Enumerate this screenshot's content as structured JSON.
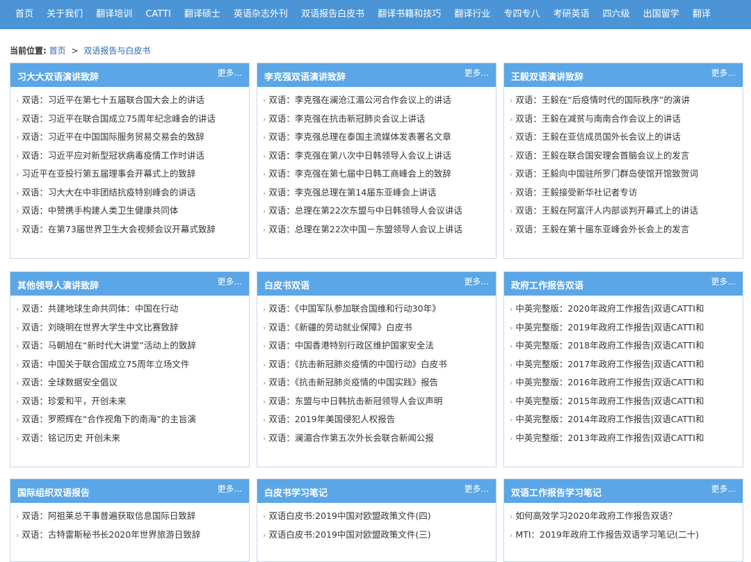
{
  "nav": [
    "首页",
    "关于我们",
    "翻译培训",
    "CATTI",
    "翻译硕士",
    "英语杂志外刊",
    "双语报告白皮书",
    "翻译书籍和技巧",
    "翻译行业",
    "专四专八",
    "考研英语",
    "四六级",
    "出国留学",
    "翻译"
  ],
  "breadcrumb": {
    "prefix": "当前位置:",
    "home": "首页",
    "sep": ">",
    "current": "双语报告与白皮书"
  },
  "more_label": "更多...",
  "panels": [
    {
      "title": "习大大双语演讲致辞",
      "items": [
        "双语：习近平在第七十五届联合国大会上的讲话",
        "双语：习近平在联合国成立75周年纪念峰会的讲话",
        "双语：习近平在中国国际服务贸易交易会的致辞",
        "双语：习近平应对新型冠状病毒疫情工作时讲话",
        "习近平在亚投行第五届理事会开幕式上的致辞",
        "双语：习大大在中非团结抗疫特别峰会的讲话",
        "双语：中赞携手构建人类卫生健康共同体",
        "双语：在第73届世界卫生大会视频会议开幕式致辞"
      ]
    },
    {
      "title": "李克强双语演讲致辞",
      "items": [
        "双语：李克强在澜沧江湄公河合作会议上的讲话",
        "双语：李克强在抗击新冠肺炎会议上讲话",
        "双语：李克强总理在泰国主流媒体发表署名文章",
        "双语：李克强在第八次中日韩领导人会议上讲话",
        "双语：李克强在第七届中日韩工商峰会上的致辞",
        "双语：李克强总理在第14届东亚峰会上讲话",
        "双语：总理在第22次东盟与中日韩领导人会议讲话",
        "双语：总理在第22次中国－东盟领导人会议上讲话"
      ]
    },
    {
      "title": "王毅双语演讲致辞",
      "items": [
        "双语：王毅在“后疫情时代的国际秩序”的演讲",
        "双语：王毅在减贫与南南合作会议上的讲话",
        "双语：王毅在亚信成员国外长会议上的讲话",
        "双语：王毅在联合国安理会首脑会议上的发言",
        "双语：王毅向中国驻所罗门群岛使馆开馆致贺词",
        "双语：王毅接受新华社记者专访",
        "双语：王毅在阿富汗人内部谈判开幕式上的讲话",
        "双语：王毅在第十届东亚峰会外长会上的发言"
      ]
    },
    {
      "title": "其他领导人演讲致辞",
      "items": [
        "双语：共建地球生命共同体：中国在行动",
        "双语：刘晓明在世界大学生中文比赛致辞",
        "双语：马朝旭在“新时代大讲堂”活动上的致辞",
        "双语：中国关于联合国成立75周年立场文件",
        "双语：全球数据安全倡议",
        "双语：珍爱和平，开创未来",
        "双语：罗照辉在“合作视角下的南海”的主旨演",
        "双语：铭记历史 开创未来"
      ]
    },
    {
      "title": "白皮书双语",
      "items": [
        "双语：《中国军队参加联合国维和行动30年》",
        "双语：《新疆的劳动就业保障》白皮书",
        "双语：中国香港特别行政区维护国家安全法",
        "双语：《抗击新冠肺炎疫情的中国行动》白皮书",
        "双语：《抗击新冠肺炎疫情的中国实践》报告",
        "双语：东盟与中日韩抗击新冠领导人会议声明",
        "双语：2019年美国侵犯人权报告",
        "双语：澜湄合作第五次外长会联合新闻公报"
      ]
    },
    {
      "title": "政府工作报告双语",
      "items": [
        "中英完整版：2020年政府工作报告|双语CATTI和",
        "中英完整版：2019年政府工作报告|双语CATTI和",
        "中英完整版：2018年政府工作报告|双语CATTI和",
        "中英完整版：2017年政府工作报告|双语CATTI和",
        "中英完整版：2016年政府工作报告|双语CATTI和",
        "中英完整版：2015年政府工作报告|双语CATTI和",
        "中英完整版：2014年政府工作报告|双语CATTI和",
        "中英完整版：2013年政府工作报告|双语CATTI和"
      ]
    },
    {
      "title": "国际组织双语报告",
      "items": [
        "双语：阿祖莱总干事普遍获取信息国际日致辞",
        "双语：古特雷斯秘书长2020年世界旅游日致辞"
      ]
    },
    {
      "title": "白皮书学习笔记",
      "items": [
        "双语白皮书:2019中国对欧盟政策文件(四)",
        "双语白皮书:2019中国对欧盟政策文件(三)"
      ]
    },
    {
      "title": "双语工作报告学习笔记",
      "items": [
        "如何高效学习2020年政府工作报告双语？",
        "MTI：2019年政府工作报告双语学习笔记(二十)"
      ]
    }
  ]
}
